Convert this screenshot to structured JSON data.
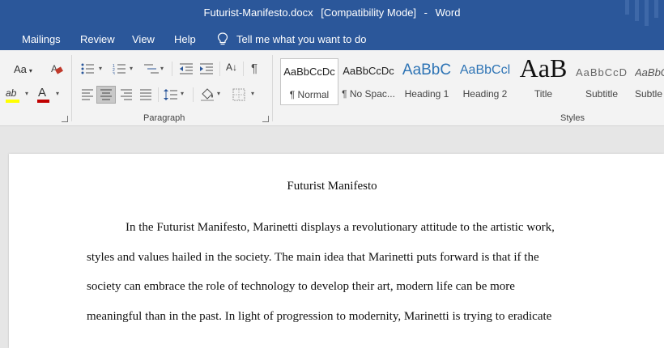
{
  "titlebar": {
    "filename": "Futurist-Manifesto.docx",
    "mode": "[Compatibility Mode]",
    "separator": "-",
    "app": "Word"
  },
  "tabs": [
    {
      "label": "Mailings"
    },
    {
      "label": "Review"
    },
    {
      "label": "View"
    },
    {
      "label": "Help"
    }
  ],
  "tell_me": {
    "label": "Tell me what you want to do",
    "icon": "lightbulb-icon"
  },
  "ribbon": {
    "paragraph_label": "Paragraph",
    "styles_label": "Styles",
    "font_case_label": "Aa",
    "font_color_letter": "A",
    "highlight_letters": "ab",
    "sort_label": "A↓",
    "pilcrow": "¶",
    "colors": {
      "font_color": "#c00000",
      "highlight": "#ffff00",
      "eraser": "#c0392b"
    }
  },
  "styles": [
    {
      "sample": "AaBbCcDc",
      "name": "¶ Normal"
    },
    {
      "sample": "AaBbCcDc",
      "name": "¶ No Spac..."
    },
    {
      "sample": "AaBbC",
      "name": "Heading 1"
    },
    {
      "sample": "AaBbCcl",
      "name": "Heading 2"
    },
    {
      "sample": "AaB",
      "name": "Title"
    },
    {
      "sample": "AaBbCcD",
      "name": "Subtitle"
    },
    {
      "sample": "AaBbC",
      "name": "Subtle"
    }
  ],
  "document": {
    "title": "Futurist Manifesto",
    "lines": [
      "In the Futurist Manifesto, Marinetti displays a revolutionary attitude to the artistic work,",
      "styles and values hailed in the society. The main idea that Marinetti puts forward is that if the",
      "society can embrace the role of technology to develop their art, modern life can be more",
      "meaningful than in the past. In light of progression to modernity, Marinetti is trying to eradicate"
    ]
  }
}
